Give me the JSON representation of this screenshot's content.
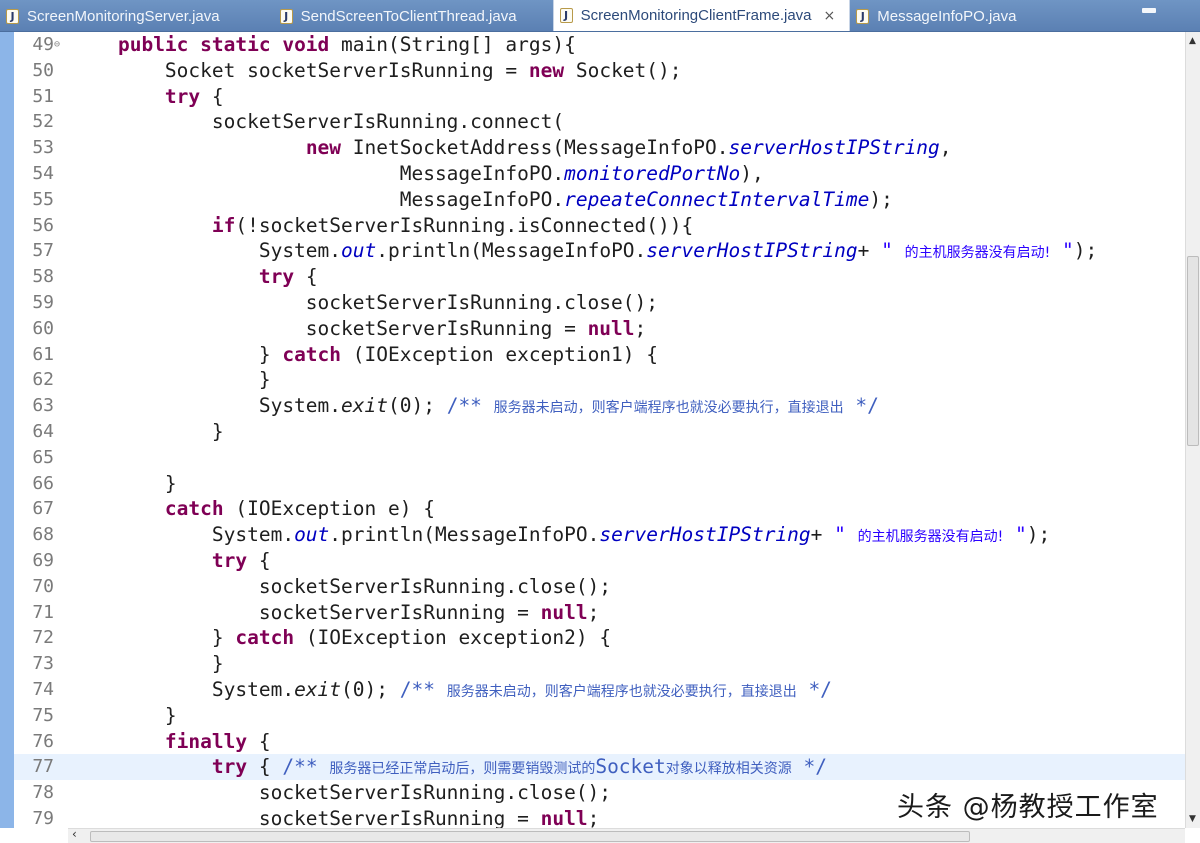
{
  "tabs": [
    {
      "label": "ScreenMonitoringServer.java",
      "icon": "java-file-icon",
      "active": false
    },
    {
      "label": "SendScreenToClientThread.java",
      "icon": "java-file-icon",
      "active": false
    },
    {
      "label": "ScreenMonitoringClientFrame.java",
      "icon": "java-file-icon",
      "active": true,
      "close": "×"
    },
    {
      "label": "MessageInfoPO.java",
      "icon": "java-file-icon",
      "active": false
    }
  ],
  "editor": {
    "current_line": 77,
    "lines": [
      {
        "n": "49",
        "fold": "⊖",
        "segs": [
          [
            "    ",
            ""
          ],
          [
            "public static void",
            "kw"
          ],
          [
            " main(String[] args){",
            ""
          ]
        ]
      },
      {
        "n": "50",
        "segs": [
          [
            "        Socket socketServerIsRunning = ",
            ""
          ],
          [
            "new",
            "kw"
          ],
          [
            " Socket();",
            ""
          ]
        ]
      },
      {
        "n": "51",
        "segs": [
          [
            "        ",
            ""
          ],
          [
            "try",
            "kw"
          ],
          [
            " {",
            ""
          ]
        ]
      },
      {
        "n": "52",
        "segs": [
          [
            "            socketServerIsRunning.connect(",
            ""
          ]
        ]
      },
      {
        "n": "53",
        "segs": [
          [
            "                    ",
            ""
          ],
          [
            "new",
            "kw"
          ],
          [
            " InetSocketAddress(MessageInfoPO.",
            ""
          ],
          [
            "serverHostIPString",
            "fld"
          ],
          [
            ",",
            ""
          ]
        ]
      },
      {
        "n": "54",
        "segs": [
          [
            "                            MessageInfoPO.",
            ""
          ],
          [
            "monitoredPortNo",
            "fld"
          ],
          [
            "),",
            ""
          ]
        ]
      },
      {
        "n": "55",
        "segs": [
          [
            "                            MessageInfoPO.",
            ""
          ],
          [
            "repeateConnectIntervalTime",
            "fld"
          ],
          [
            ");",
            ""
          ]
        ]
      },
      {
        "n": "56",
        "segs": [
          [
            "            ",
            ""
          ],
          [
            "if",
            "kw"
          ],
          [
            "(!socketServerIsRunning.isConnected()){",
            ""
          ]
        ]
      },
      {
        "n": "57",
        "segs": [
          [
            "                System.",
            ""
          ],
          [
            "out",
            "st"
          ],
          [
            ".println(MessageInfoPO.",
            ""
          ],
          [
            "serverHostIPString",
            "fld"
          ],
          [
            "+ ",
            ""
          ],
          [
            "\" ",
            "str"
          ],
          [
            "的主机服务器没有启动!",
            "str cjk"
          ],
          [
            " \"",
            "str"
          ],
          [
            ");",
            ""
          ]
        ]
      },
      {
        "n": "58",
        "segs": [
          [
            "                ",
            ""
          ],
          [
            "try",
            "kw"
          ],
          [
            " {",
            ""
          ]
        ]
      },
      {
        "n": "59",
        "segs": [
          [
            "                    socketServerIsRunning.close();",
            ""
          ]
        ]
      },
      {
        "n": "60",
        "segs": [
          [
            "                    socketServerIsRunning = ",
            ""
          ],
          [
            "null",
            "kw"
          ],
          [
            ";",
            ""
          ]
        ]
      },
      {
        "n": "61",
        "segs": [
          [
            "                } ",
            ""
          ],
          [
            "catch",
            "kw"
          ],
          [
            " (IOException exception1) {",
            ""
          ]
        ]
      },
      {
        "n": "62",
        "segs": [
          [
            "                }",
            ""
          ]
        ]
      },
      {
        "n": "63",
        "segs": [
          [
            "                System.",
            ""
          ],
          [
            "exit",
            "it"
          ],
          [
            "(0); ",
            ""
          ],
          [
            "/** ",
            "cmt"
          ],
          [
            "服务器未启动，则客户端程序也就没必要执行，直接退出",
            "cmt cjk"
          ],
          [
            " */",
            "cmt"
          ]
        ]
      },
      {
        "n": "64",
        "segs": [
          [
            "            }",
            ""
          ]
        ]
      },
      {
        "n": "65",
        "segs": [
          [
            "",
            ""
          ]
        ]
      },
      {
        "n": "66",
        "segs": [
          [
            "        }",
            ""
          ]
        ]
      },
      {
        "n": "67",
        "segs": [
          [
            "        ",
            ""
          ],
          [
            "catch",
            "kw"
          ],
          [
            " (IOException e) {",
            ""
          ]
        ]
      },
      {
        "n": "68",
        "segs": [
          [
            "            System.",
            ""
          ],
          [
            "out",
            "st"
          ],
          [
            ".println(MessageInfoPO.",
            ""
          ],
          [
            "serverHostIPString",
            "fld"
          ],
          [
            "+ ",
            ""
          ],
          [
            "\" ",
            "str"
          ],
          [
            "的主机服务器没有启动!",
            "str cjk"
          ],
          [
            " \"",
            "str"
          ],
          [
            ");",
            ""
          ]
        ]
      },
      {
        "n": "69",
        "segs": [
          [
            "            ",
            ""
          ],
          [
            "try",
            "kw"
          ],
          [
            " {",
            ""
          ]
        ]
      },
      {
        "n": "70",
        "segs": [
          [
            "                socketServerIsRunning.close();",
            ""
          ]
        ]
      },
      {
        "n": "71",
        "segs": [
          [
            "                socketServerIsRunning = ",
            ""
          ],
          [
            "null",
            "kw"
          ],
          [
            ";",
            ""
          ]
        ]
      },
      {
        "n": "72",
        "segs": [
          [
            "            } ",
            ""
          ],
          [
            "catch",
            "kw"
          ],
          [
            " (IOException exception2) {",
            ""
          ]
        ]
      },
      {
        "n": "73",
        "segs": [
          [
            "            }",
            ""
          ]
        ]
      },
      {
        "n": "74",
        "segs": [
          [
            "            System.",
            ""
          ],
          [
            "exit",
            "it"
          ],
          [
            "(0); ",
            ""
          ],
          [
            "/** ",
            "cmt"
          ],
          [
            "服务器未启动，则客户端程序也就没必要执行，直接退出",
            "cmt cjk"
          ],
          [
            " */",
            "cmt"
          ]
        ]
      },
      {
        "n": "75",
        "segs": [
          [
            "        }",
            ""
          ]
        ]
      },
      {
        "n": "76",
        "segs": [
          [
            "        ",
            ""
          ],
          [
            "finally",
            "kw"
          ],
          [
            " {",
            ""
          ]
        ]
      },
      {
        "n": "77",
        "segs": [
          [
            "            ",
            ""
          ],
          [
            "try",
            "kw"
          ],
          [
            " { ",
            ""
          ],
          [
            "/** ",
            "cmt"
          ],
          [
            "服务器已经正常启动后，则需要销毁测试的",
            "cmt cjk"
          ],
          [
            "Socket",
            "cmt"
          ],
          [
            "对象以释放相关资源",
            "cmt cjk"
          ],
          [
            " */",
            "cmt"
          ]
        ]
      },
      {
        "n": "78",
        "segs": [
          [
            "                socketServerIsRunning.close();",
            ""
          ]
        ]
      },
      {
        "n": "79",
        "segs": [
          [
            "                socketServerIsRunning = ",
            ""
          ],
          [
            "null",
            "kw"
          ],
          [
            ";",
            ""
          ]
        ]
      }
    ]
  },
  "scrollbars": {
    "vertical_up": "▲",
    "vertical_down": "▼",
    "horizontal_left": "‹"
  },
  "watermark": "头条 @杨教授工作室"
}
